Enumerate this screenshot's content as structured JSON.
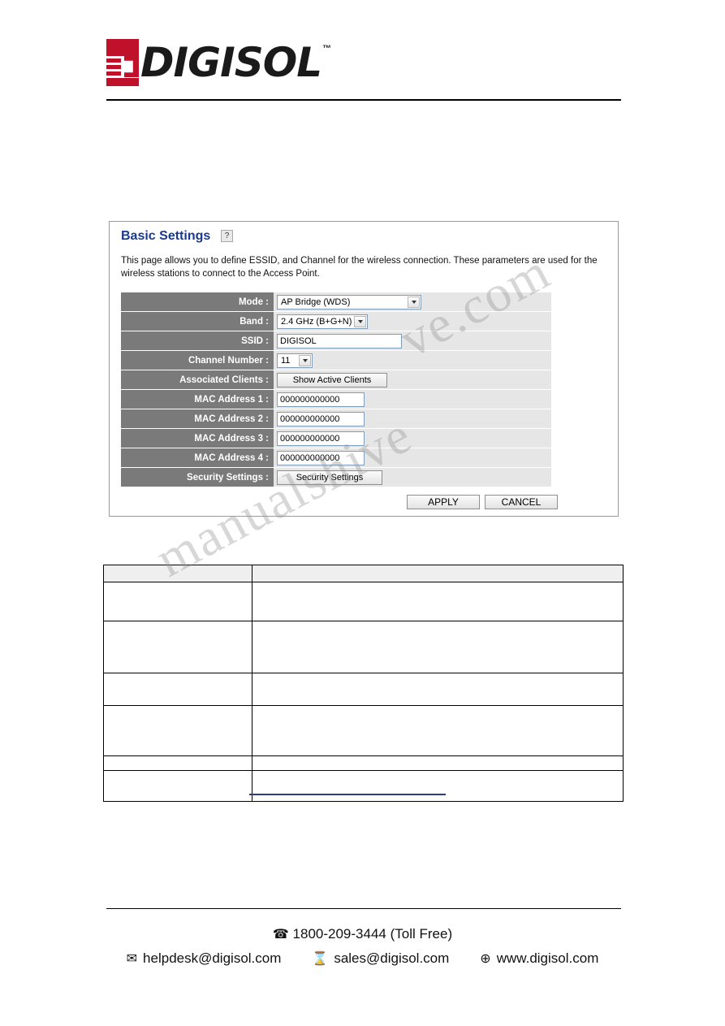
{
  "brand": {
    "logo_text": "DIGISOL",
    "trademark": "™"
  },
  "panel": {
    "title": "Basic Settings",
    "help_icon": "?",
    "description": "This page allows you to define ESSID, and Channel for the wireless connection. These parameters are used for the wireless stations to connect to the Access Point.",
    "fields": [
      {
        "label": "Mode :",
        "control": "select",
        "value": "AP Bridge (WDS)"
      },
      {
        "label": "Band :",
        "control": "select",
        "value": "2.4 GHz (B+G+N)"
      },
      {
        "label": "SSID :",
        "control": "text",
        "value": "DIGISOL"
      },
      {
        "label": "Channel Number :",
        "control": "select",
        "value": "11"
      },
      {
        "label": "Associated Clients :",
        "control": "button",
        "value": "Show Active Clients"
      },
      {
        "label": "MAC Address 1 :",
        "control": "text",
        "value": "000000000000"
      },
      {
        "label": "MAC Address 2 :",
        "control": "text",
        "value": "000000000000"
      },
      {
        "label": "MAC Address 3 :",
        "control": "text",
        "value": "000000000000"
      },
      {
        "label": "MAC Address 4 :",
        "control": "text",
        "value": "000000000000"
      },
      {
        "label": "Security Settings :",
        "control": "button",
        "value": "Security Settings"
      }
    ],
    "apply_label": "APPLY",
    "cancel_label": "CANCEL"
  },
  "watermark": {
    "line1": "ve.com",
    "line2": "manualshive"
  },
  "table": {
    "rows": [
      {
        "col1": "",
        "col2": ""
      },
      {
        "col1": "",
        "col2": ""
      },
      {
        "col1": "",
        "col2": ""
      },
      {
        "col1": "",
        "col2": ""
      },
      {
        "col1": "",
        "col2": ""
      },
      {
        "col1": "",
        "col2": ""
      },
      {
        "col1": "",
        "col2": ""
      }
    ]
  },
  "footer": {
    "phone_icon": "☎",
    "phone": "1800-209-3444 (Toll Free)",
    "email_icon": "✉",
    "email": "helpdesk@digisol.com",
    "sales_icon": "⌛",
    "sales": "sales@digisol.com",
    "web_icon": "⊕",
    "web": "www.digisol.com"
  }
}
